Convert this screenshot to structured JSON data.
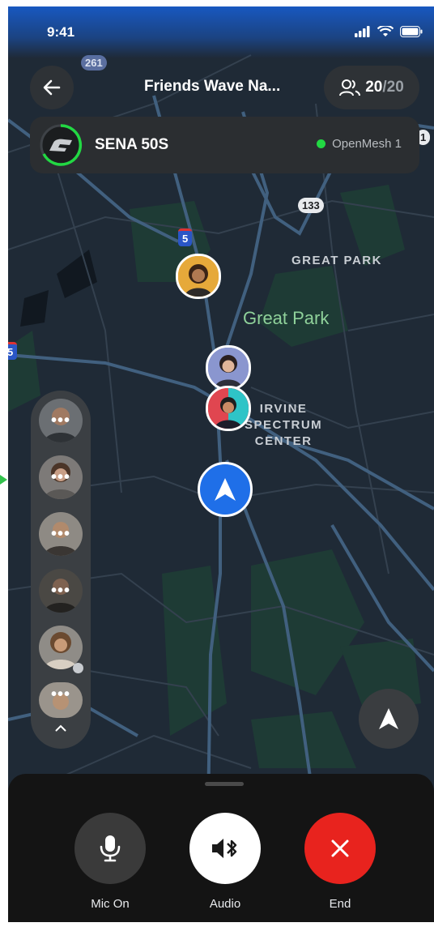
{
  "status_bar": {
    "time": "9:41"
  },
  "header": {
    "title": "Friends Wave Na...",
    "members_current": "20",
    "members_total": "/20"
  },
  "device": {
    "name": "SENA 50S",
    "mesh_label": "OpenMesh 1",
    "mesh_color": "#22d843"
  },
  "map": {
    "labels": {
      "great_park_caps": "GREAT PARK",
      "great_park": "Great Park",
      "irvine_line1": "IRVINE",
      "irvine_line2": "SPECTRUM",
      "irvine_line3": "CENTER"
    },
    "shields": [
      "261",
      "133",
      "5",
      "5",
      "1"
    ]
  },
  "participants": {
    "more_label": "•••",
    "count_visible": 6
  },
  "controls": {
    "mic_label": "Mic On",
    "audio_label": "Audio",
    "end_label": "End"
  },
  "colors": {
    "accent_blue": "#1f6fe8",
    "end_red": "#e8231e",
    "park_green": "#8fd19a"
  }
}
